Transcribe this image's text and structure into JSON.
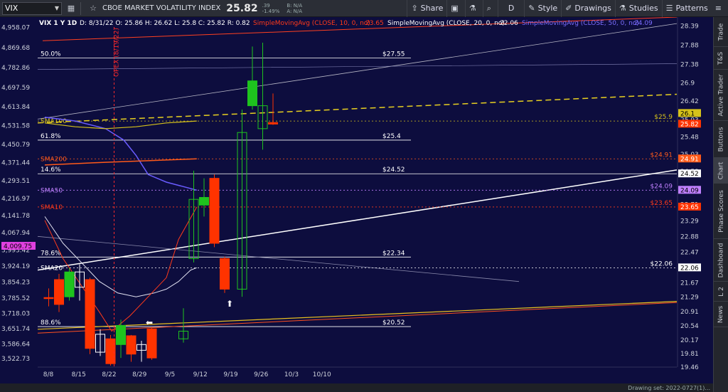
{
  "toolbar": {
    "symbol": "VIX",
    "description": "CBOE MARKET VOLATILITY INDEX",
    "last": "25.82",
    "change": ".39",
    "change_pct": "-1.49%",
    "bid": "B: N/A",
    "ask": "A: N/A",
    "share": "Share",
    "d": "D",
    "style": "Style",
    "drawings": "Drawings",
    "studies": "Studies",
    "patterns": "Patterns"
  },
  "chart_header": {
    "symbol": "VIX 1 Y 1D",
    "ohlc": "D: 8/31/22  O: 25.86  H: 26.62  L: 25.8  C: 25.82  R: 0.82",
    "sma10": "SimpleMovingAvg (CLOSE, 10, 0, no)",
    "sma10_val": "23.65",
    "sma20": "SimpleMovingAvg (CLOSE, 20, 0, no)",
    "sma20_val": "22.06",
    "sma50": "SimpleMovingAvg (CLOSE, 50, 0, no)",
    "sma50_val": "24.09"
  },
  "colors": {
    "background": "#0d0d3e",
    "up_candle": "#1ec31e",
    "down_candle": "#ff3300",
    "sma10": "#ff3a1a",
    "sma20": "#e0e0f0",
    "sma50": "#6a5cff",
    "sma100": "#d6c21a",
    "sma200": "#ff5a1a",
    "fib": "#ffffff",
    "trend_yellow": "#e8d020"
  },
  "chart_data": {
    "type": "candlestick",
    "title": "VIX 1 Y 1D",
    "right_axis": {
      "ticks": [
        "28.39",
        "27.88",
        "27.38",
        "26.9",
        "26.42",
        "25.93",
        "25.48",
        "25.03",
        "24.58",
        "24.13",
        "23.71",
        "23.29",
        "22.88",
        "22.47",
        "22.06",
        "21.67",
        "21.29",
        "20.91",
        "20.54",
        "20.17",
        "19.81",
        "19.46"
      ],
      "range": [
        19.46,
        28.62
      ]
    },
    "left_axis": {
      "ticks": [
        "4,958.07",
        "4,869.68",
        "4,782.86",
        "4,697.59",
        "4,613.84",
        "4,531.58",
        "4,450.79",
        "4,371.44",
        "4,293.51",
        "4,216.97",
        "4,141.78",
        "4,067.94",
        "3,993.42",
        "3,924.19",
        "3,854.23",
        "3,785.52",
        "3,718.03",
        "3,651.74",
        "3,586.64",
        "3,522.73"
      ],
      "range": [
        3486.0,
        5002.0
      ],
      "marker": "4,009.75"
    },
    "x_labels": [
      "8/8",
      "8/15",
      "8/22",
      "8/29",
      "9/5",
      "9/12",
      "9/19",
      "9/26",
      "10/3",
      "10/10"
    ],
    "vline": "OPEX (8/19/22)",
    "fib_levels": [
      {
        "pct": "50.0%",
        "value": "$27.55",
        "level": 27.55
      },
      {
        "pct": "61.8%",
        "value": "$25.4",
        "level": 25.4
      },
      {
        "pct": "14.6%",
        "value": "$24.52",
        "level": 24.52
      },
      {
        "pct": "78.6%",
        "value": "$22.34",
        "level": 22.34
      },
      {
        "pct": "88.6%",
        "value": "$20.52",
        "level": 20.52
      }
    ],
    "sma_labels": [
      {
        "name": "SMA100",
        "value": "$25.9",
        "level": 25.9
      },
      {
        "name": "SMA200",
        "value": "$24.91",
        "level": 24.91
      },
      {
        "name": "SMA50",
        "value": "$24.09",
        "level": 24.09
      },
      {
        "name": "SMA10",
        "value": "$23.65",
        "level": 23.65
      },
      {
        "name": "SMA20",
        "value": "$22.06",
        "level": 22.06
      }
    ],
    "price_tags": [
      {
        "value": "26.1",
        "level": 26.1
      },
      {
        "value": "25.82",
        "level": 25.82
      },
      {
        "value": "24.91",
        "level": 24.91
      },
      {
        "value": "24.52",
        "level": 24.52
      },
      {
        "value": "24.09",
        "level": 24.09
      },
      {
        "value": "23.65",
        "level": 23.65
      },
      {
        "value": "22.06",
        "level": 22.06
      }
    ],
    "candles_vix": [
      {
        "o": 21.28,
        "c": 21.28,
        "h": 21.52,
        "l": 21.05,
        "cls": "down"
      },
      {
        "o": 21.75,
        "c": 21.1,
        "h": 21.9,
        "l": 20.9,
        "cls": "down"
      },
      {
        "o": 21.3,
        "c": 21.95,
        "h": 22.05,
        "l": 21.2,
        "cls": "up"
      },
      {
        "o": 21.95,
        "c": 21.55,
        "h": 22.15,
        "l": 21.2,
        "cls": "neutral"
      },
      {
        "o": 21.75,
        "c": 19.95,
        "h": 21.8,
        "l": 19.8,
        "cls": "down"
      },
      {
        "o": 19.85,
        "c": 20.32,
        "h": 20.45,
        "l": 19.75,
        "cls": "neutral"
      },
      {
        "o": 20.2,
        "c": 19.55,
        "h": 20.3,
        "l": 19.5,
        "cls": "down"
      },
      {
        "o": 20.05,
        "c": 20.55,
        "h": 20.7,
        "l": 19.7,
        "cls": "up"
      },
      {
        "o": 20.28,
        "c": 19.8,
        "h": 20.3,
        "l": 19.6,
        "cls": "down"
      },
      {
        "o": 19.9,
        "c": 20.05,
        "h": 20.15,
        "l": 19.6,
        "cls": "neutral"
      },
      {
        "o": 20.46,
        "c": 19.7,
        "h": 20.5,
        "l": 19.65,
        "cls": "down"
      },
      {
        "o": 20.2,
        "c": 20.4,
        "h": 21.0,
        "l": 20.1,
        "cls": "neutral"
      },
      {
        "o": 22.3,
        "c": 23.85,
        "h": 24.6,
        "l": 22.2,
        "cls": "neutral"
      },
      {
        "o": 23.7,
        "c": 23.9,
        "h": 24.4,
        "l": 23.4,
        "cls": "up"
      },
      {
        "o": 24.4,
        "c": 22.7,
        "h": 24.5,
        "l": 22.6,
        "cls": "down"
      },
      {
        "o": 22.3,
        "c": 21.5,
        "h": 22.35,
        "l": 21.4,
        "cls": "down"
      },
      {
        "o": 21.5,
        "c": 25.6,
        "h": 26.2,
        "l": 21.3,
        "cls": "neutral"
      },
      {
        "o": 26.3,
        "c": 26.95,
        "h": 27.85,
        "l": 26.2,
        "cls": "up"
      },
      {
        "o": 26.3,
        "c": 25.7,
        "h": 27.95,
        "l": 25.15,
        "cls": "neutral"
      },
      {
        "o": 25.86,
        "c": 25.82,
        "h": 26.62,
        "l": 25.8,
        "cls": "down"
      }
    ]
  },
  "side_tabs": [
    "Trade",
    "T&S",
    "Active Trader",
    "Buttons",
    "Chart",
    "Phase Scores",
    "Dashboard",
    "L 2",
    "News"
  ],
  "status": "Drawing set: 2022-0727(1)..."
}
